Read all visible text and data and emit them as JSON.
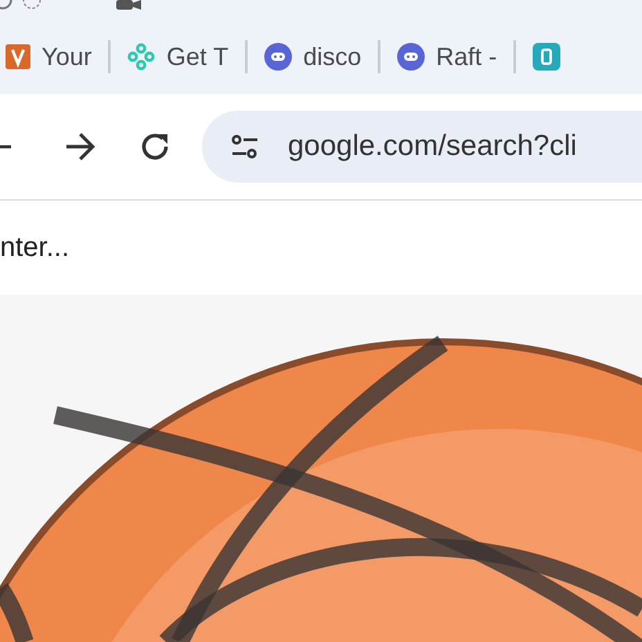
{
  "bookmarks": [
    {
      "label": "Your",
      "kind": "letter"
    },
    {
      "label": "Get T",
      "kind": "dots"
    },
    {
      "label": "disco",
      "kind": "chat"
    },
    {
      "label": "Raft -",
      "kind": "chat"
    },
    {
      "kind": "tile"
    }
  ],
  "address_bar": {
    "url": "google.com/search?cli"
  },
  "page": {
    "heading": "nter..."
  }
}
